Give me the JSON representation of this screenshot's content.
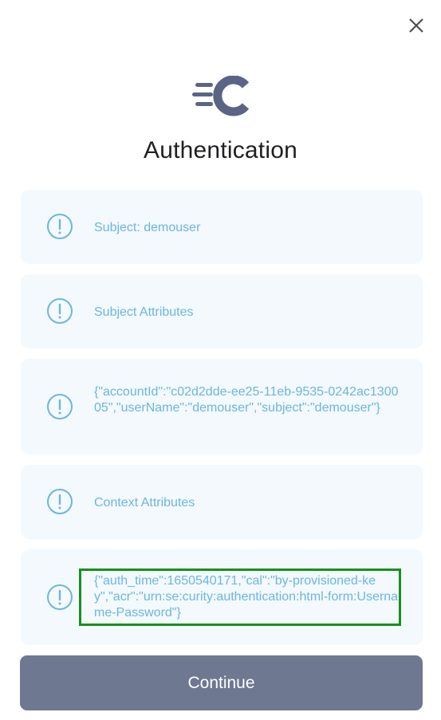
{
  "dialog": {
    "title": "Authentication",
    "close_icon": "close-icon",
    "logo_icon": "curity-logo-icon"
  },
  "messages": [
    {
      "icon": "info-circle-icon",
      "text": "Subject: demouser"
    },
    {
      "icon": "info-circle-icon",
      "text": "Subject Attributes"
    },
    {
      "icon": "info-circle-icon",
      "text": "{\"accountId\":\"c02d2dde-ee25-11eb-9535-0242ac130005\",\"userName\":\"demouser\",\"subject\":\"demouser\"}"
    },
    {
      "icon": "info-circle-icon",
      "text": "Context Attributes"
    },
    {
      "icon": "info-circle-icon",
      "text": "{\"auth_time\":1650540171,\"cal\":\"by-provisioned-key\",\"acr\":\"urn:se:curity:authentication:html-form:Username-Password\"}"
    }
  ],
  "actions": {
    "continue_label": "Continue"
  },
  "colors": {
    "card_background": "#f3f9fd",
    "info_text": "#6db6de",
    "button_background": "#6f7891",
    "highlight_border": "#18901e",
    "logo": "#5a6585"
  }
}
